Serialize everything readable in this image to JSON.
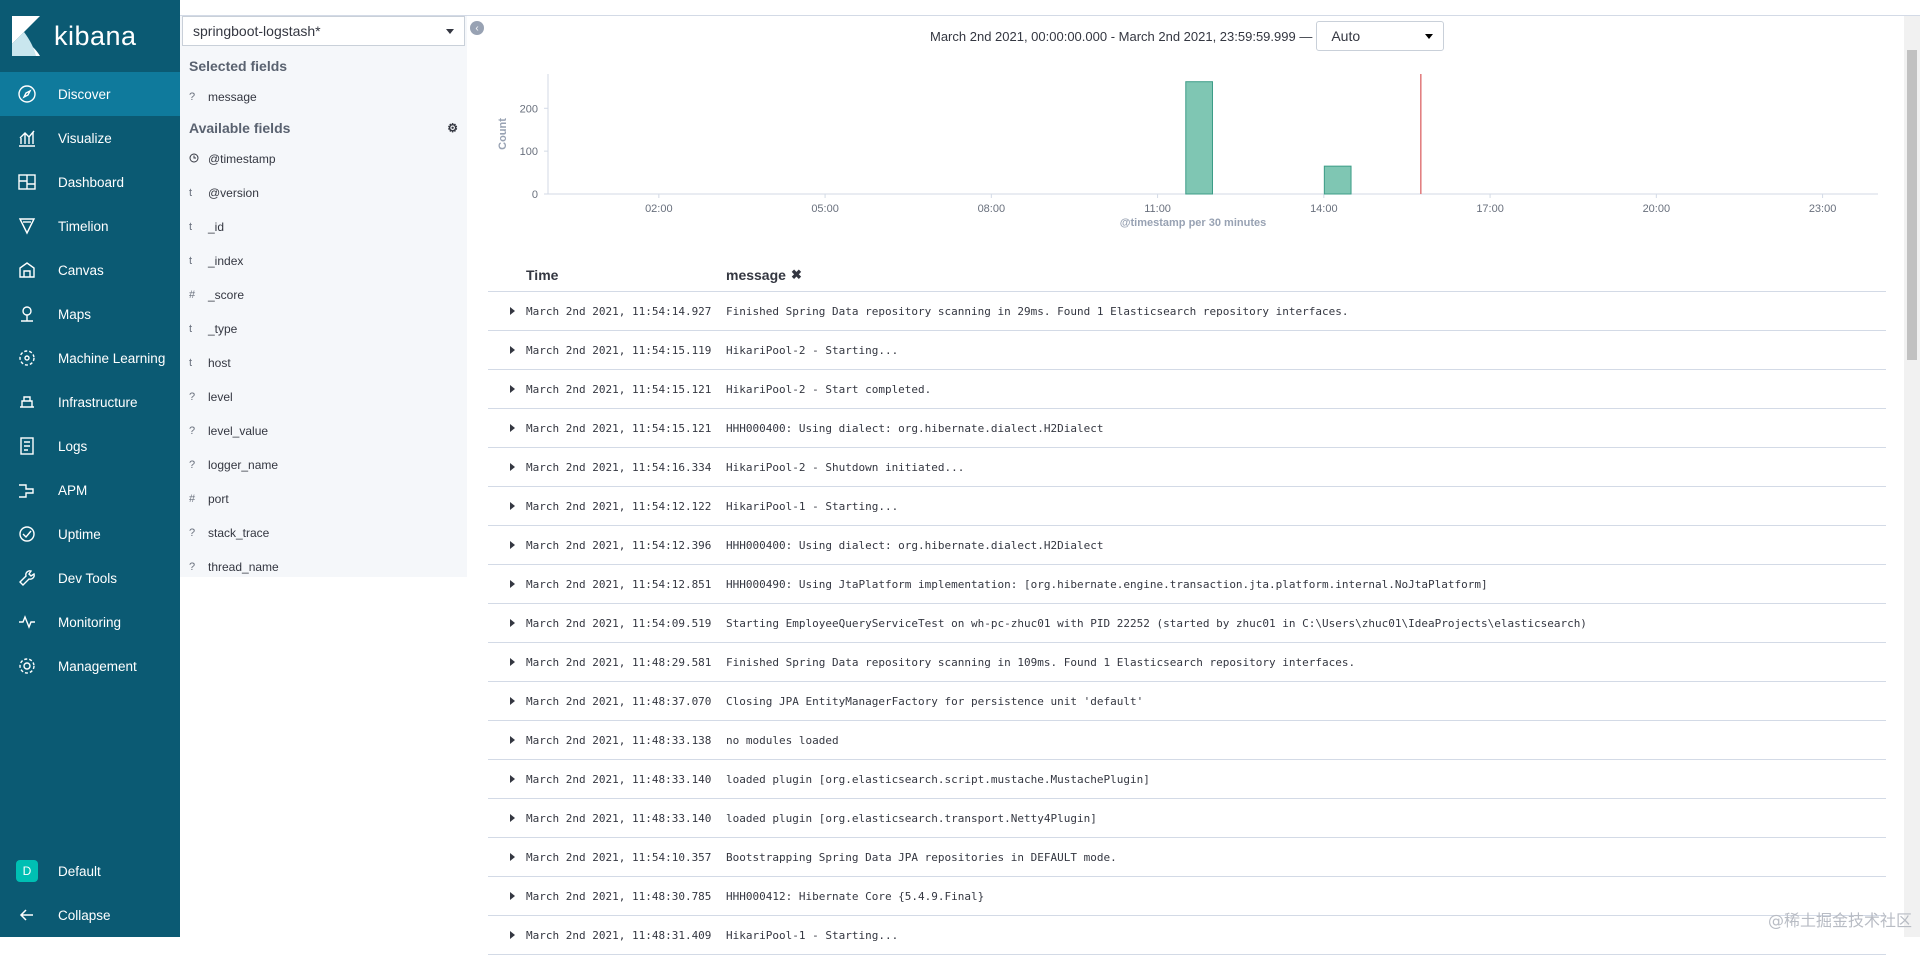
{
  "nav": {
    "brand": "kibana",
    "items": [
      {
        "label": "Discover",
        "icon": "compass-icon",
        "active": true
      },
      {
        "label": "Visualize",
        "icon": "visualize-icon"
      },
      {
        "label": "Dashboard",
        "icon": "dashboard-icon"
      },
      {
        "label": "Timelion",
        "icon": "timelion-icon"
      },
      {
        "label": "Canvas",
        "icon": "canvas-icon"
      },
      {
        "label": "Maps",
        "icon": "maps-icon"
      },
      {
        "label": "Machine Learning",
        "icon": "machine-learning-icon"
      },
      {
        "label": "Infrastructure",
        "icon": "infrastructure-icon"
      },
      {
        "label": "Logs",
        "icon": "logs-icon"
      },
      {
        "label": "APM",
        "icon": "apm-icon"
      },
      {
        "label": "Uptime",
        "icon": "uptime-icon"
      },
      {
        "label": "Dev Tools",
        "icon": "wrench-icon"
      },
      {
        "label": "Monitoring",
        "icon": "monitoring-icon"
      },
      {
        "label": "Management",
        "icon": "gear-icon"
      }
    ],
    "space_initial": "D",
    "space_label": "Default",
    "collapse_label": "Collapse"
  },
  "sidebar": {
    "index_pattern": "springboot-logstash*",
    "selected_title": "Selected fields",
    "selected_fields": [
      {
        "type": "?",
        "name": "message"
      }
    ],
    "available_title": "Available fields",
    "available_fields": [
      {
        "type": "clock",
        "name": "@timestamp"
      },
      {
        "type": "t",
        "name": "@version"
      },
      {
        "type": "t",
        "name": "_id"
      },
      {
        "type": "t",
        "name": "_index"
      },
      {
        "type": "#",
        "name": "_score"
      },
      {
        "type": "t",
        "name": "_type"
      },
      {
        "type": "t",
        "name": "host"
      },
      {
        "type": "?",
        "name": "level"
      },
      {
        "type": "?",
        "name": "level_value"
      },
      {
        "type": "?",
        "name": "logger_name"
      },
      {
        "type": "#",
        "name": "port"
      },
      {
        "type": "?",
        "name": "stack_trace"
      },
      {
        "type": "?",
        "name": "thread_name"
      }
    ]
  },
  "timebar": {
    "range": "March 2nd 2021, 00:00:00.000 - March 2nd 2021, 23:59:59.999 —",
    "interval": "Auto"
  },
  "chart_data": {
    "type": "bar",
    "ylabel": "Count",
    "xlabel": "@timestamp per 30 minutes",
    "y_ticks": [
      0,
      100,
      200
    ],
    "ylim": [
      0,
      280
    ],
    "x_domain_hours": [
      0,
      24
    ],
    "x_ticks": [
      "02:00",
      "05:00",
      "08:00",
      "11:00",
      "14:00",
      "17:00",
      "20:00",
      "23:00"
    ],
    "bars": [
      {
        "start": "11:30",
        "value": 262
      },
      {
        "start": "14:00",
        "value": 65
      }
    ],
    "now_marker": "15:45",
    "bar_color": "#54b399",
    "now_color": "#e0787a"
  },
  "table": {
    "col_time": "Time",
    "col_message": "message",
    "rows": [
      {
        "time": "March 2nd 2021, 11:54:14.927",
        "message": "Finished Spring Data repository scanning in 29ms. Found 1 Elasticsearch repository interfaces."
      },
      {
        "time": "March 2nd 2021, 11:54:15.119",
        "message": "HikariPool-2 - Starting..."
      },
      {
        "time": "March 2nd 2021, 11:54:15.121",
        "message": "HikariPool-2 - Start completed."
      },
      {
        "time": "March 2nd 2021, 11:54:15.121",
        "message": "HHH000400: Using dialect: org.hibernate.dialect.H2Dialect"
      },
      {
        "time": "March 2nd 2021, 11:54:16.334",
        "message": "HikariPool-2 - Shutdown initiated..."
      },
      {
        "time": "March 2nd 2021, 11:54:12.122",
        "message": "HikariPool-1 - Starting..."
      },
      {
        "time": "March 2nd 2021, 11:54:12.396",
        "message": "HHH000400: Using dialect: org.hibernate.dialect.H2Dialect"
      },
      {
        "time": "March 2nd 2021, 11:54:12.851",
        "message": "HHH000490: Using JtaPlatform implementation: [org.hibernate.engine.transaction.jta.platform.internal.NoJtaPlatform]"
      },
      {
        "time": "March 2nd 2021, 11:54:09.519",
        "message": "Starting EmployeeQueryServiceTest on wh-pc-zhuc01 with PID 22252 (started by zhuc01 in C:\\Users\\zhuc01\\IdeaProjects\\elasticsearch)"
      },
      {
        "time": "March 2nd 2021, 11:48:29.581",
        "message": "Finished Spring Data repository scanning in 109ms. Found 1 Elasticsearch repository interfaces."
      },
      {
        "time": "March 2nd 2021, 11:48:37.070",
        "message": "Closing JPA EntityManagerFactory for persistence unit 'default'"
      },
      {
        "time": "March 2nd 2021, 11:48:33.138",
        "message": "no modules loaded"
      },
      {
        "time": "March 2nd 2021, 11:48:33.140",
        "message": "loaded plugin [org.elasticsearch.script.mustache.MustachePlugin]"
      },
      {
        "time": "March 2nd 2021, 11:48:33.140",
        "message": "loaded plugin [org.elasticsearch.transport.Netty4Plugin]"
      },
      {
        "time": "March 2nd 2021, 11:54:10.357",
        "message": "Bootstrapping Spring Data JPA repositories in DEFAULT mode."
      },
      {
        "time": "March 2nd 2021, 11:48:30.785",
        "message": "HHH000412: Hibernate Core {5.4.9.Final}"
      },
      {
        "time": "March 2nd 2021, 11:48:31.409",
        "message": "HikariPool-1 - Starting..."
      }
    ]
  },
  "watermark": "@稀土掘金技术社区"
}
